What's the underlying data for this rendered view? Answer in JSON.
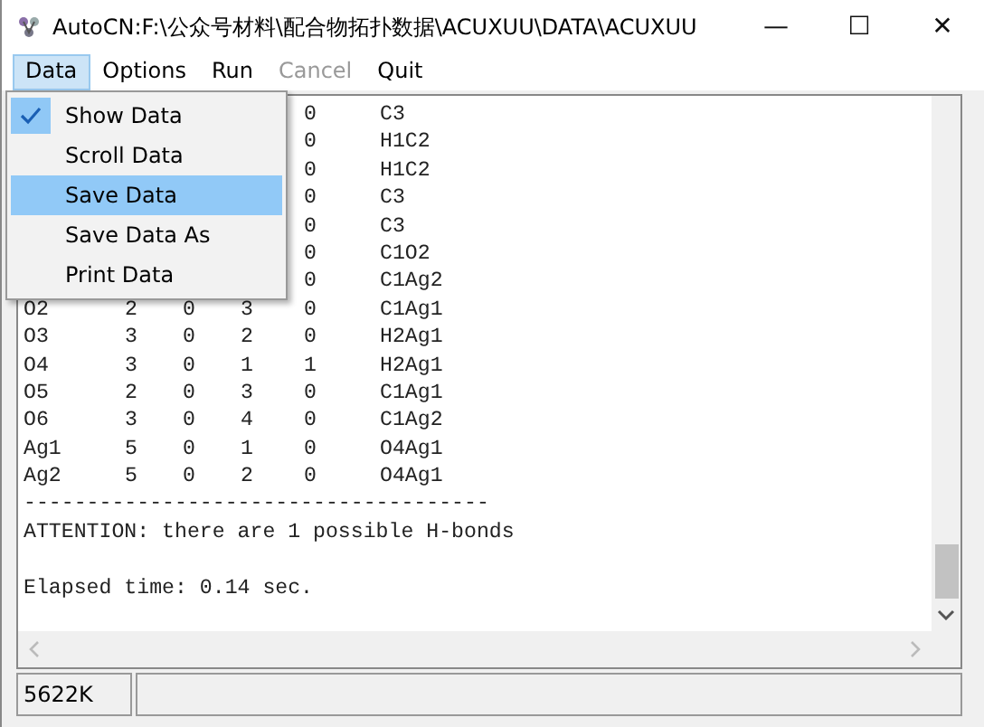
{
  "window": {
    "title": "AutoCN:F:\\公众号材料\\配合物拓扑数据\\ACUXUU\\DATA\\ACUXUU",
    "controls": [
      "—",
      "☐",
      "✕"
    ]
  },
  "menu_bar": [
    {
      "label": "Data",
      "selected": true,
      "disabled": false
    },
    {
      "label": "Options",
      "selected": false,
      "disabled": false
    },
    {
      "label": "Run",
      "selected": false,
      "disabled": false
    },
    {
      "label": "Cancel",
      "selected": false,
      "disabled": true
    },
    {
      "label": "Quit",
      "selected": false,
      "disabled": false
    }
  ],
  "dropdown": [
    {
      "label": "Show Data",
      "checked": true,
      "selected": false
    },
    {
      "label": "Scroll Data",
      "checked": false,
      "selected": false
    },
    {
      "label": "Save Data",
      "checked": false,
      "selected": true
    },
    {
      "label": "Save Data As",
      "checked": false,
      "selected": false
    },
    {
      "label": "Print Data",
      "checked": false,
      "selected": false
    }
  ],
  "output": {
    "rows": [
      {
        "col_5": "0",
        "col_6": "C3"
      },
      {
        "col_5": "0",
        "col_6": "H1C2"
      },
      {
        "col_5": "0",
        "col_6": "H1C2"
      },
      {
        "col_5": "0",
        "col_6": "C3"
      },
      {
        "col_5": "0",
        "col_6": "C3"
      },
      {
        "col_5": "0",
        "col_6": "C1O2"
      },
      {
        "col_5": "0",
        "col_6": "C1Ag2"
      },
      {
        "col_1": "O2",
        "col_2": "2",
        "col_3": "0",
        "col_4": "3",
        "col_5": "0",
        "col_6": "C1Ag1"
      },
      {
        "col_1": "O3",
        "col_2": "3",
        "col_3": "0",
        "col_4": "2",
        "col_5": "0",
        "col_6": "H2Ag1"
      },
      {
        "col_1": "O4",
        "col_2": "3",
        "col_3": "0",
        "col_4": "1",
        "col_5": "1",
        "col_6": "H2Ag1"
      },
      {
        "col_1": "O5",
        "col_2": "2",
        "col_3": "0",
        "col_4": "3",
        "col_5": "0",
        "col_6": "C1Ag1"
      },
      {
        "col_1": "O6",
        "col_2": "3",
        "col_3": "0",
        "col_4": "4",
        "col_5": "0",
        "col_6": "C1Ag2"
      },
      {
        "col_1": "Ag1",
        "col_2": "5",
        "col_3": "0",
        "col_4": "1",
        "col_5": "0",
        "col_6": "O4Ag1"
      },
      {
        "col_1": "Ag2",
        "col_2": "5",
        "col_3": "0",
        "col_4": "2",
        "col_5": "0",
        "col_6": "O4Ag1"
      }
    ],
    "lines": [
      "-------------------------------------",
      "ATTENTION: there are 1 possible H-bonds"
    ],
    "timing": "Elapsed time: 0.14 sec."
  },
  "status_bar": [
    "5622K"
  ]
}
